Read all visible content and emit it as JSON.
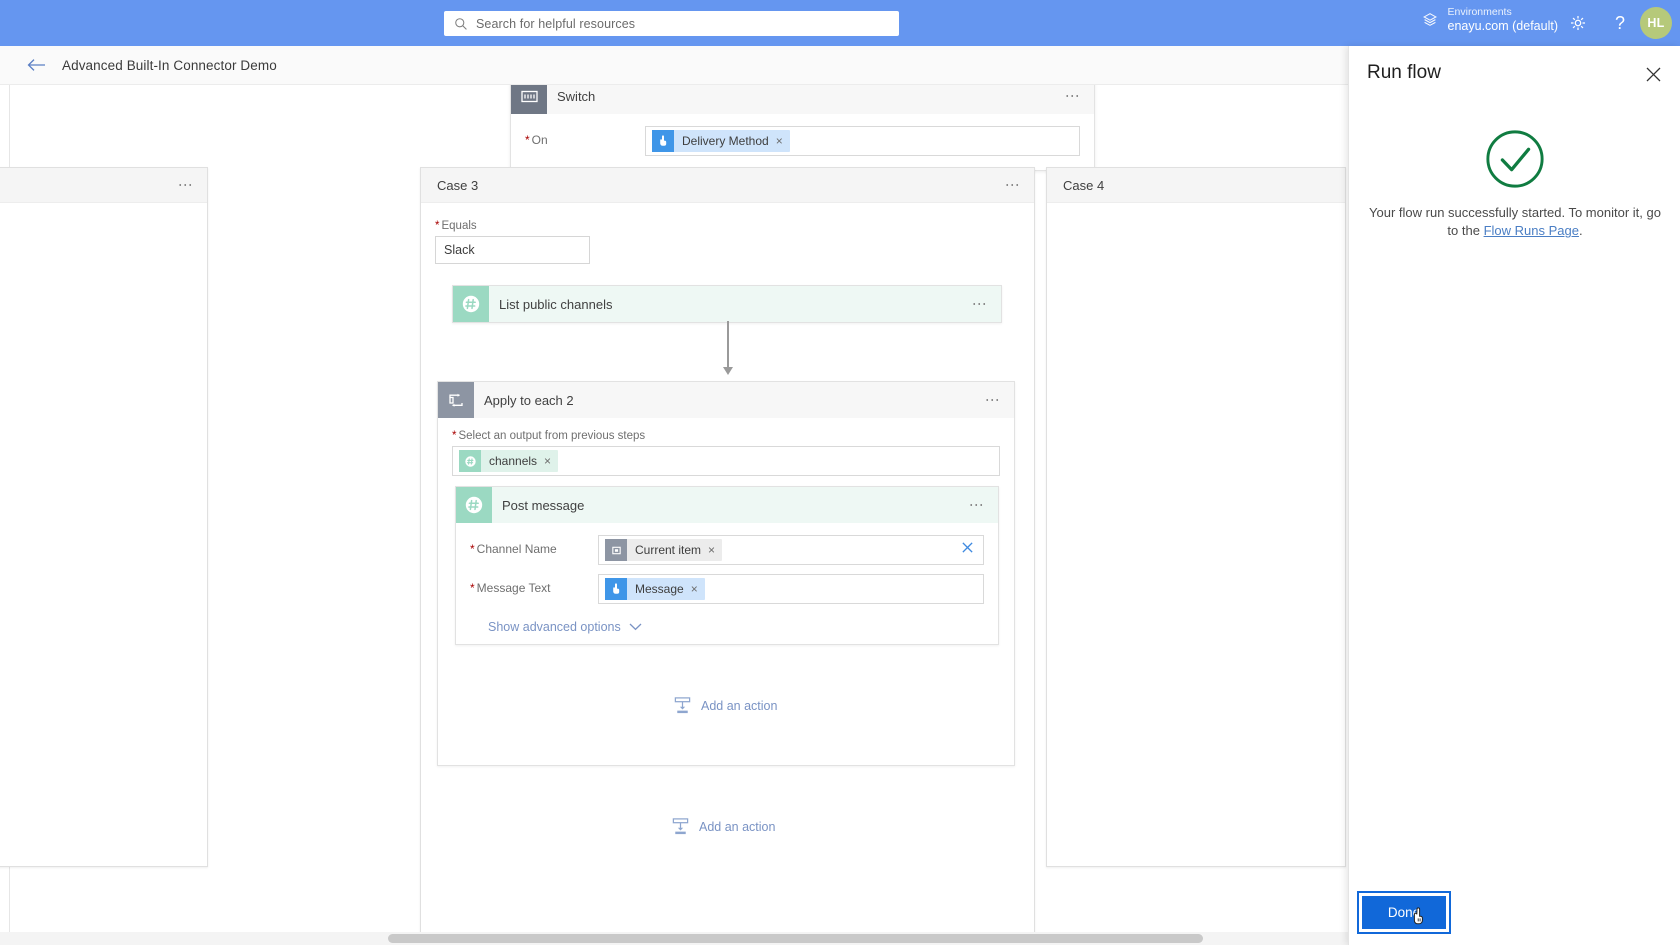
{
  "header": {
    "search_placeholder": "Search for helpful resources",
    "search_icon": "search-icon",
    "environments_label": "Environments",
    "environment_name": "enayu.com (default)",
    "environment_icon": "environment-icon",
    "settings_icon": "gear-icon",
    "help_icon": "question-mark-icon",
    "avatar_initials": "HL"
  },
  "command_bar": {
    "back_icon": "back-arrow-icon",
    "flow_title": "Advanced Built-In Connector Demo"
  },
  "canvas": {
    "switch_node": {
      "title": "Switch",
      "icon": "switch-icon",
      "menu_icon": "ellipsis-icon",
      "field_label": "On",
      "required": true,
      "token": {
        "label": "Delivery Method",
        "icon": "manual-trigger-icon",
        "remove": "×"
      }
    },
    "cases": [
      {
        "name": "case-2",
        "title": "",
        "menu_icon": "ellipsis-icon"
      },
      {
        "name": "case-3",
        "title": "Case 3",
        "menu_icon": "ellipsis-icon"
      },
      {
        "name": "case-4",
        "title": "Case 4",
        "menu_icon": "ellipsis-icon"
      }
    ],
    "case3": {
      "title": "Case 3",
      "equals_label": "Equals",
      "equals_value": "Slack",
      "list_channels": {
        "title": "List public channels",
        "icon": "slack-icon",
        "menu_icon": "ellipsis-icon"
      },
      "apply_to_each": {
        "title": "Apply to each 2",
        "icon": "loop-icon",
        "menu_icon": "ellipsis-icon",
        "select_label": "Select an output from previous steps",
        "select_token": {
          "label": "channels",
          "icon": "slack-output-icon",
          "remove": "×"
        },
        "post_message": {
          "title": "Post message",
          "icon": "slack-icon",
          "menu_icon": "ellipsis-icon",
          "channel_label": "Channel Name",
          "channel_token": {
            "label": "Current item",
            "icon": "loop-item-icon",
            "remove": "×"
          },
          "channel_clear_icon": "clear-field-icon",
          "message_label": "Message Text",
          "message_token": {
            "label": "Message",
            "icon": "manual-trigger-icon",
            "remove": "×"
          },
          "show_advanced": "Show advanced options",
          "show_advanced_icon": "chevron-down-icon"
        },
        "add_action_inner": {
          "label": "Add an action",
          "icon": "add-action-icon"
        }
      },
      "add_action_outer": {
        "label": "Add an action",
        "icon": "add-action-icon"
      }
    },
    "scrollbar": "horizontal-scrollbar"
  },
  "run_panel": {
    "title": "Run flow",
    "close_icon": "close-icon",
    "status_icon": "success-check-icon",
    "message_part1": "Your flow run successfully started. To monitor it, go to the ",
    "message_link": "Flow Runs Page",
    "message_part2": ".",
    "done_label": "Done"
  },
  "colors": {
    "top_bar": "#6596f0",
    "primary_button": "#1168d9",
    "success_green": "#107c41",
    "slack_mint": "#9bd9c2",
    "link_blue": "#4a7ec4"
  }
}
